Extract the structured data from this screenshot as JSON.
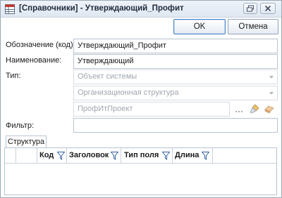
{
  "window": {
    "title": "[Справочники] - Утверждающий_Профит",
    "icons": [
      "table-app-icon",
      "restore-icon",
      "close-icon"
    ]
  },
  "buttons": {
    "ok_label": "OK",
    "cancel_label": "Отмена"
  },
  "form": {
    "code_label": "Обозначение (код):",
    "code_value": "Утверждающий_Профит",
    "name_label": "Наименование:",
    "name_value": "Утверждающий",
    "type_label": "Тип:",
    "type_value": "Объект системы",
    "subtype_value": "Организационная структура",
    "project_value": "ПрофИтПроект",
    "project_actions": [
      "ellipsis-icon",
      "brush-icon",
      "eraser-icon"
    ],
    "filter_label": "Фильтр:",
    "filter_value": ""
  },
  "tabs": {
    "structure_label": "Структура"
  },
  "grid": {
    "columns": [
      "Код",
      "Заголовок",
      "Тип поля",
      "Длина"
    ]
  },
  "colors": {
    "accent": "#4f86c6",
    "border": "#b7c3d1",
    "disabled_text": "#a0a7b0"
  }
}
